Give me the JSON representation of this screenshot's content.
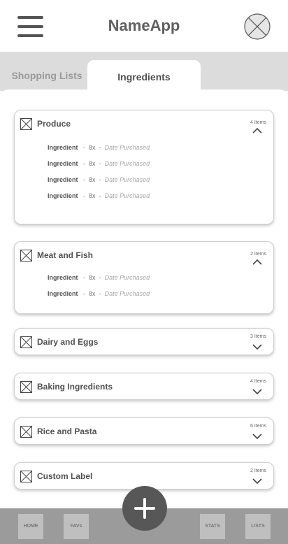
{
  "app": {
    "title": "NameApp"
  },
  "tabs": [
    {
      "label": "Shopping Lists"
    },
    {
      "label": "Ingredients"
    }
  ],
  "categories": [
    {
      "title": "Produce",
      "count": "4 Items",
      "expanded": true,
      "items": [
        {
          "name": "Ingredient",
          "qty": "8x",
          "date": "Date Purchased"
        },
        {
          "name": "Ingredient",
          "qty": "8x",
          "date": "Date Purchased"
        },
        {
          "name": "Ingredient",
          "qty": "8x",
          "date": "Date Purchased"
        },
        {
          "name": "Ingredient",
          "qty": "8x",
          "date": "Date Purchased"
        }
      ]
    },
    {
      "title": "Meat and Fish",
      "count": "2 Items",
      "expanded": true,
      "items": [
        {
          "name": "Ingredient",
          "qty": "8x",
          "date": "Date Purchased"
        },
        {
          "name": "Ingredient",
          "qty": "8x",
          "date": "Date Purchased"
        }
      ]
    },
    {
      "title": "Dairy and Eggs",
      "count": "3 Items",
      "expanded": false
    },
    {
      "title": "Baking Ingredients",
      "count": "4 Items",
      "expanded": false
    },
    {
      "title": "Rice and Pasta",
      "count": "6 Items",
      "expanded": false
    },
    {
      "title": "Custom Label",
      "count": "2 Items",
      "expanded": false
    }
  ],
  "separator": "-",
  "nav": {
    "home": "HOME",
    "favs": "FAVs",
    "stats": "STATS",
    "lists": "LISTS"
  },
  "icons": {
    "menu": "hamburger-menu-icon",
    "avatar": "avatar-placeholder-icon",
    "add": "plus-icon",
    "collapse": "chevron-up-icon",
    "expand": "chevron-down-icon",
    "category": "image-placeholder-icon"
  },
  "colors": {
    "header_bg": "#ffffff",
    "tab_bar_bg": "#dcdcdc",
    "nav_bg": "#9b9b9b",
    "fab_bg": "#575757"
  }
}
